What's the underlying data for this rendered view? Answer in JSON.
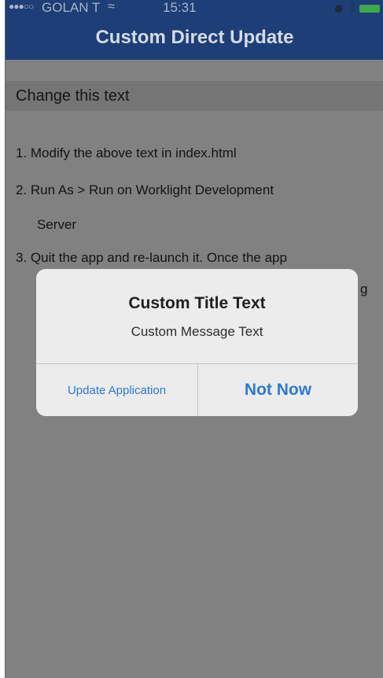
{
  "status_bar": {
    "signal_dots": "●●●○○",
    "carrier": "GOLAN T",
    "wifi": "≈",
    "time": "15:31",
    "bluetooth": "ᛒ"
  },
  "header": {
    "title": "Custom Direct Update"
  },
  "content": {
    "editable_text": "Change this text",
    "lines": [
      "1.  Modify the above text in index.html",
      "2.  Run As > Run on Worklight Development",
      "Server",
      "3.  Quit the app and re-launch it. Once the app",
      "g"
    ]
  },
  "dialog": {
    "title": "Custom Title Text",
    "message": "Custom Message Text",
    "update_label": "Update Application",
    "not_now_label": "Not Now"
  },
  "colors": {
    "header_bg": "#1d3e76",
    "screen_bg": "#818181",
    "dialog_bg": "#ececec",
    "button_text": "#2a7ad8",
    "battery": "#3fa84a"
  }
}
